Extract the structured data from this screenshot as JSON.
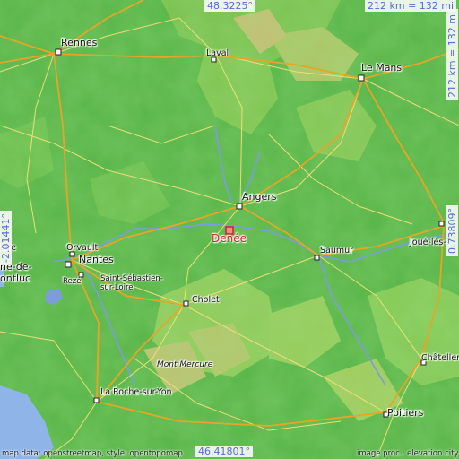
{
  "map": {
    "highlight_city": "Denée",
    "cities": {
      "rennes": "Rennes",
      "laval": "Laval",
      "le_mans": "Le Mans",
      "angers": "Angers",
      "saumur": "Saumur",
      "joue_les_tours": "Joué-lès-T",
      "orvault": "Orvault",
      "nantes": "Nantes",
      "saint_herblain": "aire",
      "saint_sebastien": "Saint-Sébastien-\nsur-Loire",
      "reze": "Rezé",
      "cholet": "Cholet",
      "mont_mercure": "Mont Mercure",
      "la_roche_sur_yon": "La Roche-sur-Yon",
      "chatellerault": "Châteller",
      "poitiers": "Poitiers",
      "montluc": "ne-de-\nontluc"
    },
    "coords": {
      "top_lat": "48.3225°",
      "bottom_lat": "46.41801°",
      "left_lon": "-2.01441°",
      "right_lon": "0.73809°",
      "scale_top": "212 km = 132 mi",
      "scale_right": "212 km = 132 mi"
    },
    "credits": {
      "left": "map data: openstreetmap, style: opentopomap",
      "right": "image proc.: elevation.city"
    },
    "colors": {
      "lowland": "#5cb84a",
      "midland": "#9fcf5a",
      "upland": "#d3c27a",
      "water": "#7f9be0",
      "road_major": "#e9b23a",
      "road_minor": "#f4e07a",
      "highlight": "#d31f27"
    }
  }
}
